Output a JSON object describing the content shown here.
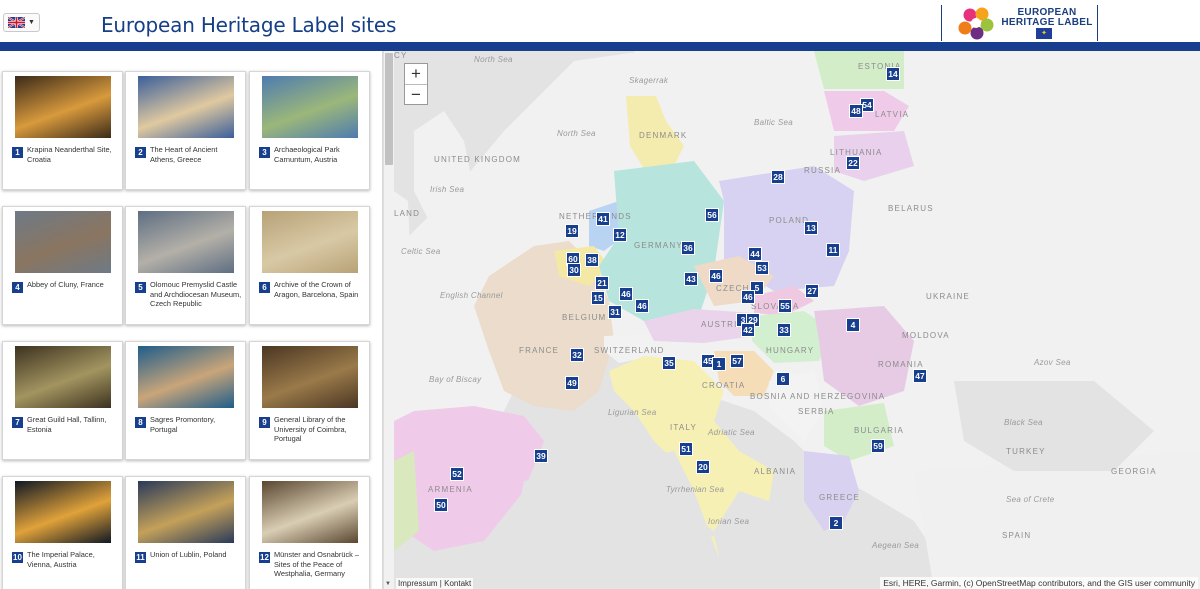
{
  "header": {
    "language": "EN",
    "title": "European Heritage Label sites",
    "logo_line1": "EUROPEAN",
    "logo_line2": "HERITAGE LABEL"
  },
  "cards": [
    {
      "num": "1",
      "caption": "Krapina Neanderthal Site, Croatia",
      "icon": "cave-photo"
    },
    {
      "num": "2",
      "caption": "The Heart of Ancient Athens, Greece",
      "icon": "temple-photo"
    },
    {
      "num": "3",
      "caption": "Archaeological Park Carnuntum, Austria",
      "icon": "villa-photo"
    },
    {
      "num": "4",
      "caption": "Abbey of Cluny, France",
      "icon": "abbey-photo"
    },
    {
      "num": "5",
      "caption": "Olomouc Premyslid Castle and Archdiocesan Museum, Czech Republic",
      "icon": "castle-photo"
    },
    {
      "num": "6",
      "caption": "Archive of the Crown of Aragon, Barcelona, Spain",
      "icon": "document-photo"
    },
    {
      "num": "7",
      "caption": "Great Guild Hall, Tallinn, Estonia",
      "icon": "hall-photo"
    },
    {
      "num": "8",
      "caption": "Sagres Promontory, Portugal",
      "icon": "coast-photo"
    },
    {
      "num": "9",
      "caption": "General Library of the University of Coimbra, Portugal",
      "icon": "library-photo"
    },
    {
      "num": "10",
      "caption": "The Imperial Palace, Vienna, Austria",
      "icon": "palace-photo"
    },
    {
      "num": "11",
      "caption": "Union of Lublin, Poland",
      "icon": "ceiling-photo"
    },
    {
      "num": "12",
      "caption": "Münster and Osnabrück – Sites of the Peace of Westphalia, Germany",
      "icon": "treaty-photo"
    }
  ],
  "map": {
    "zoom_in": "+",
    "zoom_out": "−",
    "labels": [
      {
        "text": "North Sea",
        "type": "sea"
      },
      {
        "text": "Skagerrak",
        "type": "sea"
      },
      {
        "text": "DENMARK",
        "type": "country"
      },
      {
        "text": "North Sea",
        "type": "sea"
      },
      {
        "text": "UNITED KINGDOM",
        "type": "country"
      },
      {
        "text": "Irish Sea",
        "type": "sea"
      },
      {
        "text": "Celtic Sea",
        "type": "sea"
      },
      {
        "text": "English Channel",
        "type": "sea"
      },
      {
        "text": "LAND",
        "type": "country"
      },
      {
        "text": "Bay of Biscay",
        "type": "sea"
      },
      {
        "text": "FRANCE",
        "type": "country"
      },
      {
        "text": "SWITZERLAND",
        "type": "country"
      },
      {
        "text": "GERMANY",
        "type": "country"
      },
      {
        "text": "NETHERLANDS",
        "type": "country"
      },
      {
        "text": "BELGIUM",
        "type": "country"
      },
      {
        "text": "CZECHIA",
        "type": "country"
      },
      {
        "text": "AUSTRIA",
        "type": "country"
      },
      {
        "text": "POLAND",
        "type": "country"
      },
      {
        "text": "Baltic Sea",
        "type": "sea"
      },
      {
        "text": "RUSSIA",
        "type": "country"
      },
      {
        "text": "LITHUANIA",
        "type": "country"
      },
      {
        "text": "LATVIA",
        "type": "country"
      },
      {
        "text": "ESTONIA",
        "type": "country"
      },
      {
        "text": "BELARUS",
        "type": "country"
      },
      {
        "text": "UKRAINE",
        "type": "country"
      },
      {
        "text": "MOLDOVA",
        "type": "country"
      },
      {
        "text": "SLOVAKIA",
        "type": "country"
      },
      {
        "text": "HUNGARY",
        "type": "country"
      },
      {
        "text": "ROMANIA",
        "type": "country"
      },
      {
        "text": "CROATIA",
        "type": "country"
      },
      {
        "text": "BOSNIA AND HERZEGOVINA",
        "type": "country"
      },
      {
        "text": "SERBIA",
        "type": "country"
      },
      {
        "text": "Azov Sea",
        "type": "sea"
      },
      {
        "text": "Black Sea",
        "type": "sea"
      },
      {
        "text": "BULGARIA",
        "type": "country"
      },
      {
        "text": "ITALY",
        "type": "country"
      },
      {
        "text": "Ligurian Sea",
        "type": "sea"
      },
      {
        "text": "Adriatic Sea",
        "type": "sea"
      },
      {
        "text": "Tyrrhenian Sea",
        "type": "sea"
      },
      {
        "text": "Ionian Sea",
        "type": "sea"
      },
      {
        "text": "ALBANIA",
        "type": "country"
      },
      {
        "text": "GREECE",
        "type": "country"
      },
      {
        "text": "Aegean Sea",
        "type": "sea"
      },
      {
        "text": "Sea of Crete",
        "type": "sea"
      },
      {
        "text": "TURKEY",
        "type": "country"
      },
      {
        "text": "GEORGIA",
        "type": "country"
      },
      {
        "text": "ARMENIA",
        "type": "country"
      },
      {
        "text": "SPAIN",
        "type": "country"
      },
      {
        "text": "CY",
        "type": "country"
      }
    ],
    "markers": [
      "14",
      "54",
      "48",
      "22",
      "28",
      "56",
      "41",
      "12",
      "19",
      "13",
      "36",
      "11",
      "60",
      "38",
      "30",
      "43",
      "46",
      "44",
      "53",
      "21",
      "27",
      "15",
      "46",
      "5",
      "46",
      "55",
      "31",
      "46",
      "3",
      "29",
      "42",
      "33",
      "4",
      "32",
      "35",
      "45",
      "1",
      "57",
      "47",
      "49",
      "6",
      "39",
      "51",
      "59",
      "20",
      "52",
      "50",
      "2"
    ],
    "attribution": "Esri, HERE, Garmin, (c) OpenStreetMap contributors, and the GIS user community",
    "footer_impressum": "Impressum",
    "footer_sep": "|",
    "footer_kontakt": "Kontakt"
  }
}
